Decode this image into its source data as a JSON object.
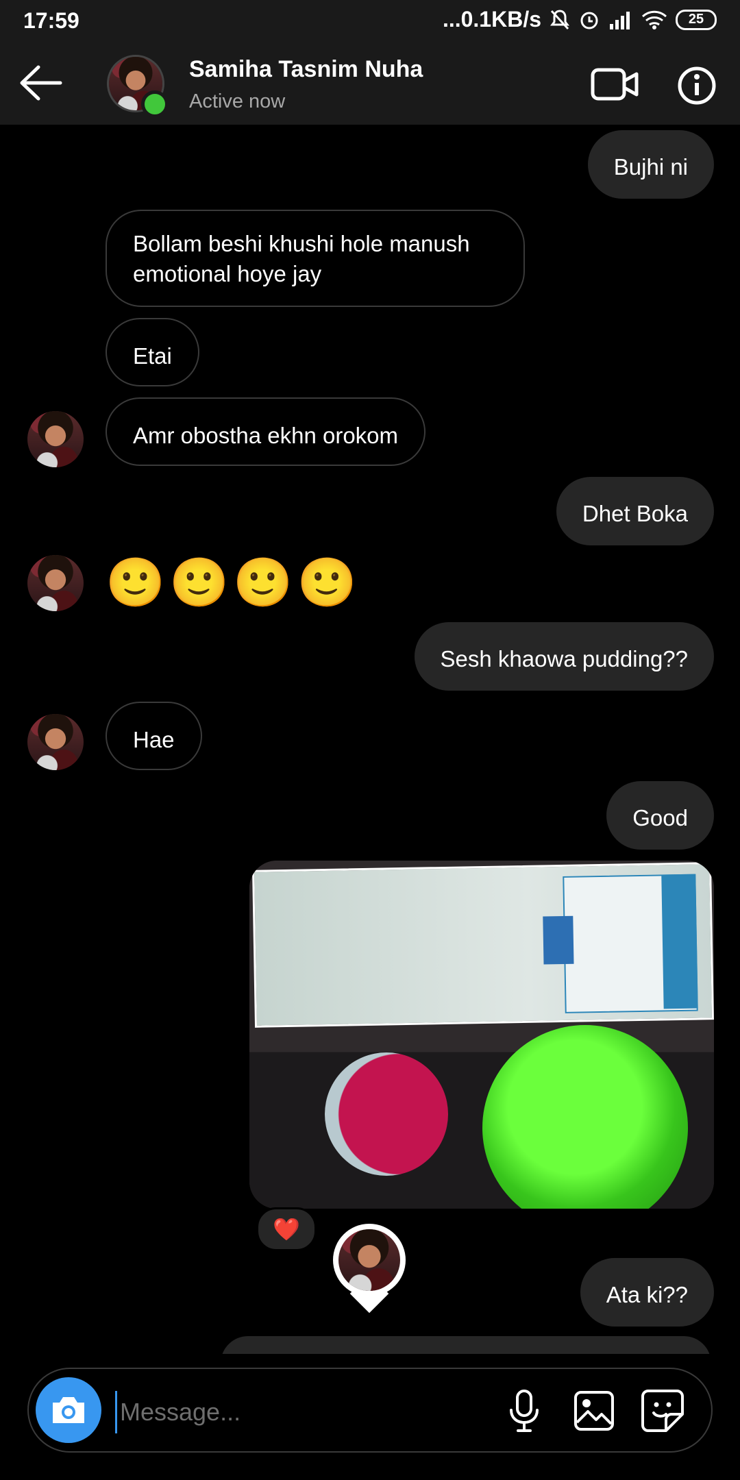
{
  "status_bar": {
    "time": "17:59",
    "network_speed": "...0.1KB/s",
    "battery": "25"
  },
  "header": {
    "name": "Samiha Tasnim Nuha",
    "status": "Active now",
    "icons": [
      "back-arrow-icon",
      "video-call-icon",
      "info-icon"
    ]
  },
  "messages": [
    {
      "side": "sent",
      "text": "Bujhi ni"
    },
    {
      "side": "received",
      "text": "Bollam beshi khushi hole manush\nemotional hoye jay"
    },
    {
      "side": "received",
      "text": "Etai"
    },
    {
      "side": "received",
      "text": "Amr obostha ekhn orokom"
    },
    {
      "side": "sent",
      "text": "Dhet Boka"
    },
    {
      "side": "received",
      "text": "🙂🙂🙂🙂"
    },
    {
      "side": "sent",
      "text": "Sesh khaowa pudding??"
    },
    {
      "side": "received",
      "text": "Hae"
    },
    {
      "side": "sent",
      "text": "Good"
    },
    {
      "side": "sent",
      "type": "photo",
      "reaction": "❤️"
    },
    {
      "side": "sent",
      "text": "Ata ki??"
    }
  ],
  "composer": {
    "placeholder": "Message...",
    "icons": [
      "camera-icon",
      "microphone-icon",
      "gallery-icon",
      "sticker-icon"
    ]
  },
  "colors": {
    "accent": "#3897f0",
    "online": "#41c73b",
    "sent_bubble": "#262626",
    "background": "#000000"
  }
}
